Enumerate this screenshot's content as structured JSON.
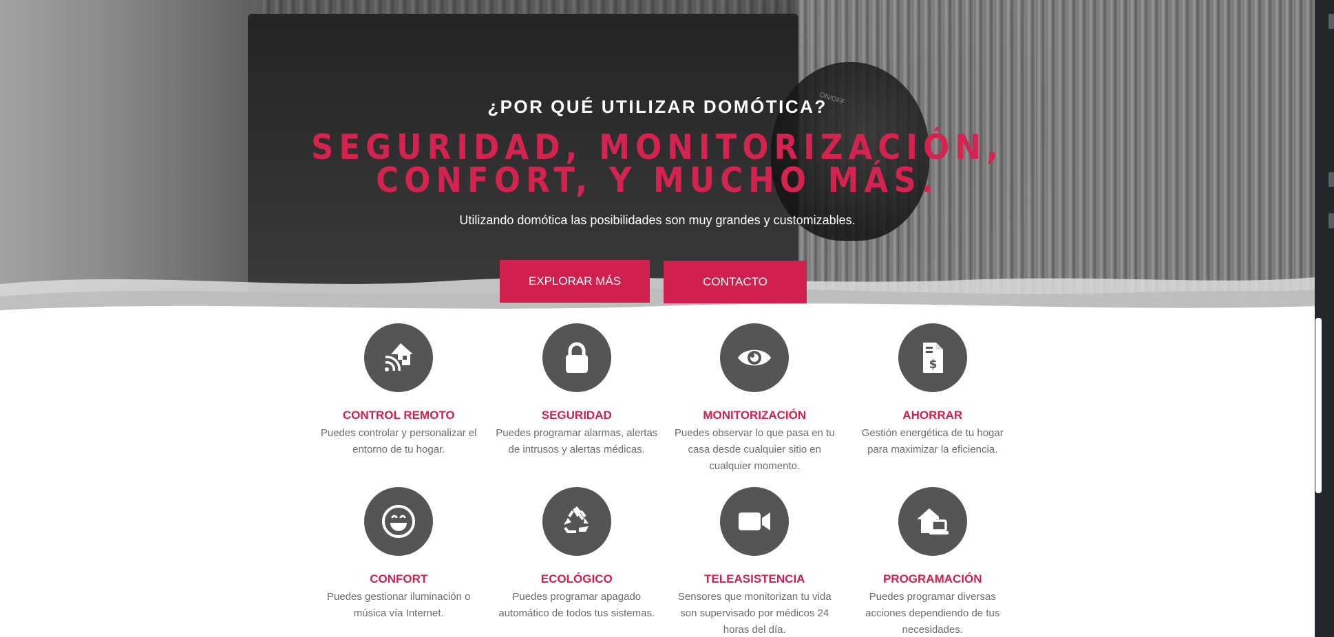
{
  "hero": {
    "eyebrow": "¿POR QUÉ UTILIZAR DOMÓTICA?",
    "headline_line1": "SEGURIDAD, MONITORIZACIÓN,",
    "headline_line2": "CONFORT, Y MUCHO MÁS.",
    "subline": "Utilizando domótica las posibilidades son muy grandes y customizables.",
    "explore_label": "EXPLORAR MÁS",
    "contact_label": "CONTACTO",
    "camera_label": "ON/OFF"
  },
  "features": [
    {
      "title": "CONTROL REMOTO",
      "text": "Puedes controlar y personalizar el entorno de tu hogar.",
      "icon": "remote-home-icon"
    },
    {
      "title": "SEGURIDAD",
      "text": "Puedes programar alarmas, alertas de intrusos y alertas médicas.",
      "icon": "lock-icon"
    },
    {
      "title": "MONITORIZACIÓN",
      "text": "Puedes observar lo que pasa en tu casa desde cualquier sitio en cualquier momento.",
      "icon": "eye-icon"
    },
    {
      "title": "AHORRAR",
      "text": "Gestión energética de tu hogar para maximizar la eficiencia.",
      "icon": "invoice-dollar-icon"
    },
    {
      "title": "CONFORT",
      "text": "Puedes gestionar iluminación o música vía Internet.",
      "icon": "smile-icon"
    },
    {
      "title": "ECOLÓGICO",
      "text": "Puedes programar apagado automático de todos tus sistemas.",
      "icon": "recycle-icon"
    },
    {
      "title": "TELEASISTENCIA",
      "text": "Sensores que monitorizan tu vida son supervisado por médicos 24 horas del día.",
      "icon": "video-camera-icon"
    },
    {
      "title": "PROGRAMACIÓN",
      "text": "Puedes programar diversas acciones dependiendo de tus necesidades.",
      "icon": "home-laptop-icon"
    }
  ],
  "colors": {
    "accent": "#d1204e",
    "icon_circle": "#555555",
    "body_text": "#6b6b6b"
  }
}
